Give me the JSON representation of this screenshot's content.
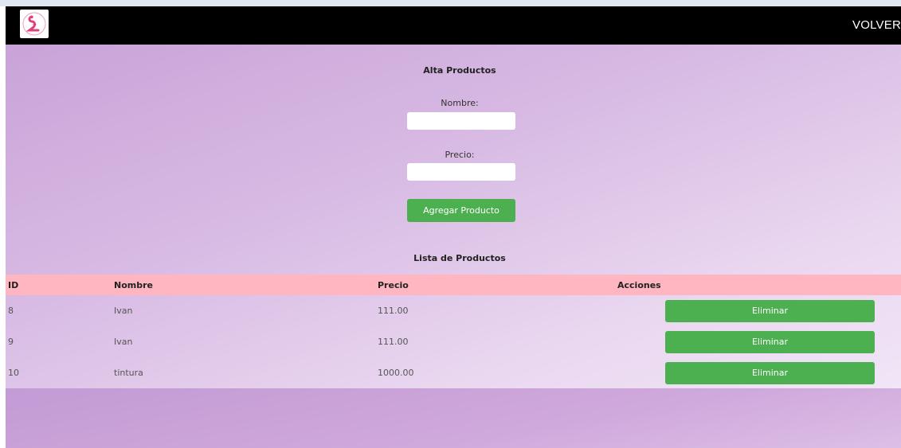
{
  "navbar": {
    "logo_icon": "flamingo-logo-icon",
    "link_label": "VOLVER"
  },
  "form": {
    "title": "Alta Productos",
    "nombre_label": "Nombre:",
    "nombre_value": "",
    "precio_label": "Precio:",
    "precio_value": "",
    "submit_label": "Agregar Producto"
  },
  "list": {
    "title": "Lista de Productos",
    "columns": [
      "ID",
      "Nombre",
      "Precio",
      "Acciones"
    ],
    "rows": [
      {
        "id": "8",
        "nombre": "Ivan",
        "precio": "111.00",
        "action": "Eliminar"
      },
      {
        "id": "9",
        "nombre": "Ivan",
        "precio": "111.00",
        "action": "Eliminar"
      },
      {
        "id": "10",
        "nombre": "tintura",
        "precio": "1000.00",
        "action": "Eliminar"
      }
    ]
  },
  "colors": {
    "navbar_bg": "#000000",
    "button_green": "#4caf50",
    "table_header_pink": "#ffb6c1",
    "background_purple": "#c9a3d8"
  }
}
